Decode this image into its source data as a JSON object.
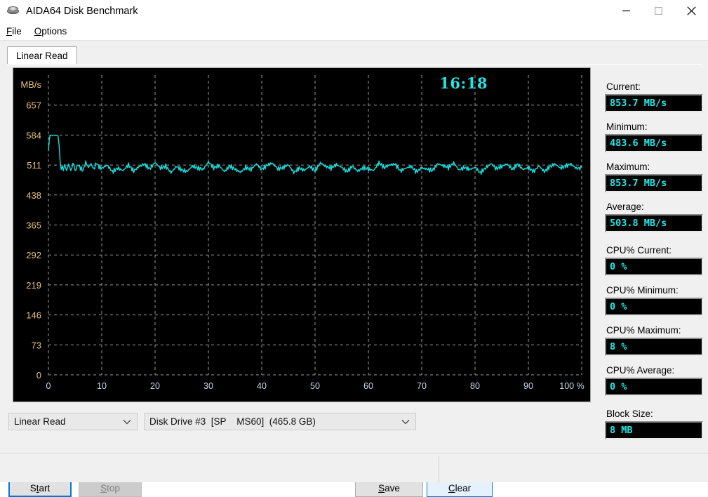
{
  "window": {
    "title": "AIDA64 Disk Benchmark",
    "icon": "disk-icon",
    "minimize_icon": "minimize-icon",
    "maximize_icon": "maximize-icon",
    "close_icon": "close-icon"
  },
  "menubar": {
    "items": [
      {
        "accel": "F",
        "rest": "ile"
      },
      {
        "accel": "O",
        "rest": "ptions"
      }
    ]
  },
  "tabs": [
    {
      "label": "Linear Read",
      "selected": true
    }
  ],
  "chart": {
    "timer": "16:18"
  },
  "controls": {
    "mode_combo": {
      "value": "Linear Read",
      "chevron": "chevron-down-icon"
    },
    "drive_combo": {
      "value": "Disk Drive #3  [SP    MS60]  (465.8 GB)",
      "chevron": "chevron-down-icon"
    },
    "start": {
      "accel": "t",
      "pre": "S",
      "post": "art"
    },
    "stop": {
      "accel": "S",
      "pre": "",
      "post": "top"
    },
    "save": {
      "accel": "S",
      "pre": "",
      "post": "ave"
    },
    "clear": {
      "accel": "C",
      "pre": "",
      "post": "lear"
    }
  },
  "readouts": [
    {
      "label": "Current:",
      "value": "853.7 MB/s"
    },
    {
      "label": "Minimum:",
      "value": "483.6 MB/s"
    },
    {
      "label": "Maximum:",
      "value": "853.7 MB/s"
    },
    {
      "label": "Average:",
      "value": "503.8 MB/s"
    },
    {
      "label": "CPU% Current:",
      "value": "0 %"
    },
    {
      "label": "CPU% Minimum:",
      "value": "0 %"
    },
    {
      "label": "CPU% Maximum:",
      "value": "8 %"
    },
    {
      "label": "CPU% Average:",
      "value": "0 %"
    },
    {
      "label": "Block Size:",
      "value": "8 MB"
    }
  ],
  "statusbar": {
    "left_text": "",
    "right_text": ""
  },
  "colors": {
    "trace": "#14e0e0",
    "timer": "#20e5e5",
    "value_text": "#22e9e9",
    "ylabel": "#e8c27a",
    "xlabel": "#c9d8ee",
    "grid": "#9a9a9a",
    "chart_bg": "#000000",
    "accent": "#0078d7"
  },
  "chart_data": {
    "type": "line",
    "title": "",
    "xlabel": "",
    "ylabel": "MB/s",
    "xlim": [
      0,
      100
    ],
    "ylim": [
      0,
      730
    ],
    "grid": true,
    "legend": null,
    "yticks": [
      0,
      73,
      146,
      219,
      292,
      365,
      438,
      511,
      584,
      657
    ],
    "ytick_labels": [
      "0",
      "73",
      "146",
      "219",
      "292",
      "365",
      "438",
      "511",
      "584",
      "657"
    ],
    "xticks": [
      0,
      10,
      20,
      30,
      40,
      50,
      60,
      70,
      80,
      90,
      100
    ],
    "xtick_labels": [
      "0",
      "10",
      "20",
      "30",
      "40",
      "50",
      "60",
      "70",
      "80",
      "90",
      "100 %"
    ],
    "series": [
      {
        "name": "Linear Read",
        "color": "#14e0e0",
        "x": [
          0.0,
          0.2,
          0.4,
          0.6,
          0.8,
          1.0,
          1.2,
          1.4,
          1.6,
          1.8,
          2.0,
          2.2,
          2.4,
          2.6,
          2.8,
          3.0,
          3.4,
          3.8,
          4.2,
          4.6,
          5.0,
          5.5,
          6.0,
          6.5,
          7.0,
          7.5,
          8.0,
          8.5,
          9.0,
          9.5,
          10.0,
          11.0,
          12.0,
          13.0,
          14.0,
          15.0,
          16.0,
          17.0,
          18.0,
          19.0,
          20.0,
          21.0,
          22.0,
          23.0,
          24.0,
          25.0,
          26.0,
          27.0,
          28.0,
          29.0,
          30.0,
          31.0,
          32.0,
          33.0,
          34.0,
          35.0,
          36.0,
          37.0,
          38.0,
          39.0,
          40.0,
          41.0,
          42.0,
          43.0,
          44.0,
          45.0,
          46.0,
          47.0,
          48.0,
          49.0,
          50.0,
          51.0,
          52.0,
          53.0,
          54.0,
          55.0,
          56.0,
          57.0,
          58.0,
          59.0,
          60.0,
          61.0,
          62.0,
          63.0,
          64.0,
          65.0,
          66.0,
          67.0,
          68.0,
          69.0,
          70.0,
          71.0,
          72.0,
          73.0,
          74.0,
          75.0,
          76.0,
          77.0,
          78.0,
          79.0,
          80.0,
          81.0,
          82.0,
          83.0,
          84.0,
          85.0,
          86.0,
          87.0,
          88.0,
          89.0,
          90.0,
          91.0,
          92.0,
          93.0,
          94.0,
          95.0,
          96.0,
          97.0,
          98.0,
          99.0,
          100.0
        ],
        "y": [
          545,
          578,
          583,
          584,
          583,
          584,
          583,
          584,
          583,
          582,
          560,
          520,
          500,
          509,
          497,
          512,
          498,
          515,
          502,
          508,
          497,
          512,
          503,
          495,
          514,
          501,
          509,
          496,
          512,
          503,
          500,
          511,
          497,
          508,
          502,
          515,
          498,
          506,
          510,
          497,
          513,
          501,
          508,
          495,
          512,
          504,
          499,
          510,
          503,
          497,
          514,
          500,
          507,
          495,
          511,
          505,
          498,
          509,
          502,
          513,
          497,
          506,
          511,
          499,
          504,
          514,
          497,
          508,
          502,
          510,
          496,
          513,
          503,
          499,
          509,
          505,
          497,
          512,
          501,
          508,
          503,
          497,
          514,
          500,
          507,
          510,
          496,
          505,
          512,
          499,
          508,
          503,
          497,
          511,
          505,
          500,
          513,
          498,
          507,
          504,
          510,
          496,
          506,
          514,
          499,
          503,
          509,
          497,
          512,
          502,
          508,
          500,
          513,
          497,
          506,
          511,
          499,
          504,
          510,
          502,
          505
        ]
      }
    ]
  }
}
